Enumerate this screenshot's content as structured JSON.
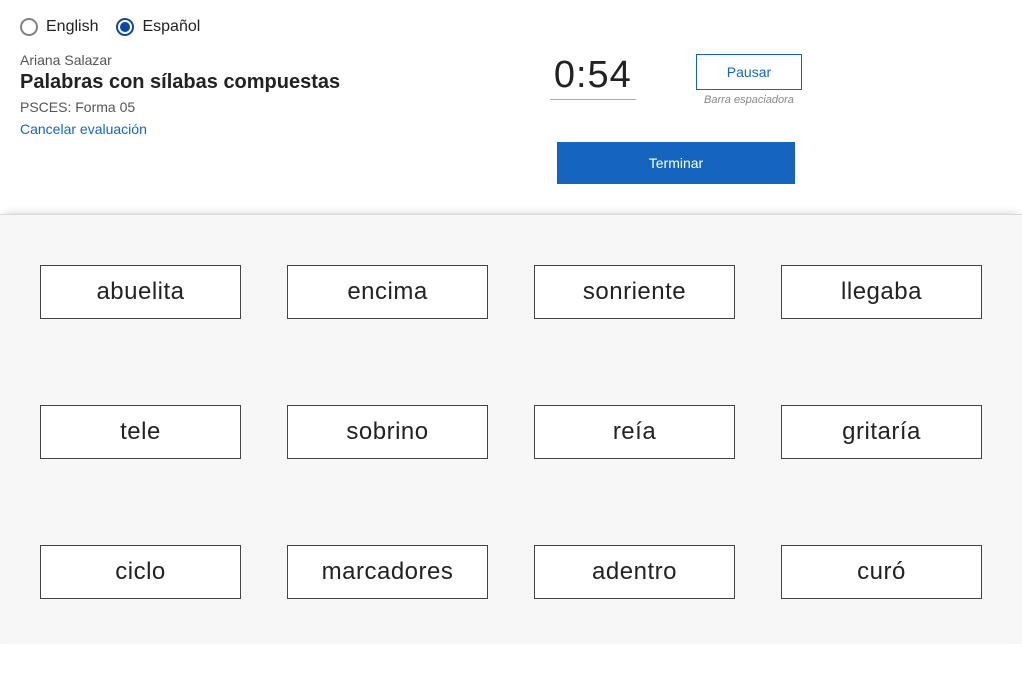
{
  "lang": {
    "options": [
      "English",
      "Español"
    ],
    "selected": "Español"
  },
  "student_name": "Ariana Salazar",
  "assessment_title": "Palabras con sílabas compuestas",
  "form_id": "PSCES: Forma 05",
  "cancel_label": "Cancelar evaluación",
  "timer": "0:54",
  "pause_label": "Pausar",
  "spacebar_hint": "Barra espaciadora",
  "finish_label": "Terminar",
  "words": [
    "abuelita",
    "encima",
    "sonriente",
    "llegaba",
    "tele",
    "sobrino",
    "reía",
    "gritaría",
    "ciclo",
    "marcadores",
    "adentro",
    "curó"
  ]
}
